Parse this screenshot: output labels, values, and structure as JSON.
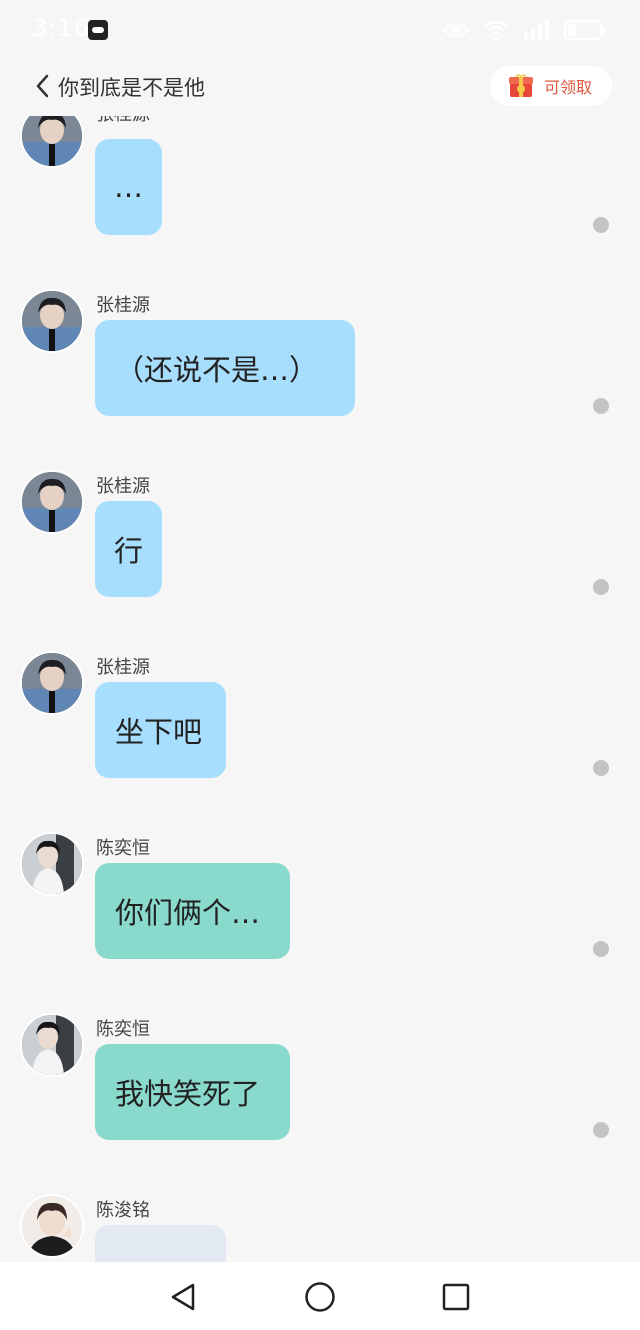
{
  "status_bar": {
    "time": "3:16",
    "icons": [
      "app-icon",
      "eye-icon",
      "wifi-icon",
      "signal-icon",
      "battery-icon"
    ]
  },
  "header": {
    "title": "你到底是不是他",
    "claim_label": "可领取",
    "claim_icon": "red-packet-icon"
  },
  "colors": {
    "blue_bubble": "#a7defd",
    "teal_bubble": "#8ad9cd",
    "gray_bubble": "#e3e9f3",
    "dot": "#c3c3c3",
    "claim_text": "#e0563f"
  },
  "messages": [
    {
      "sender": "张桂源",
      "text": "…",
      "bubble": "blue",
      "avatar": "avatar-zhang"
    },
    {
      "sender": "张桂源",
      "text": "（还说不是…）",
      "bubble": "blue",
      "avatar": "avatar-zhang"
    },
    {
      "sender": "张桂源",
      "text": "行",
      "bubble": "blue",
      "avatar": "avatar-zhang"
    },
    {
      "sender": "张桂源",
      "text": "坐下吧",
      "bubble": "blue",
      "avatar": "avatar-zhang"
    },
    {
      "sender": "陈奕恒",
      "text": "你们俩个…",
      "bubble": "teal",
      "avatar": "avatar-chen-yiheng"
    },
    {
      "sender": "陈奕恒",
      "text": "我快笑死了",
      "bubble": "teal",
      "avatar": "avatar-chen-yiheng"
    },
    {
      "sender": "陈浚铭",
      "text": "",
      "bubble": "gray",
      "avatar": "avatar-chen-junming"
    }
  ],
  "nav_bar": {
    "buttons": [
      "back-triangle-icon",
      "home-circle-icon",
      "recents-square-icon"
    ]
  }
}
